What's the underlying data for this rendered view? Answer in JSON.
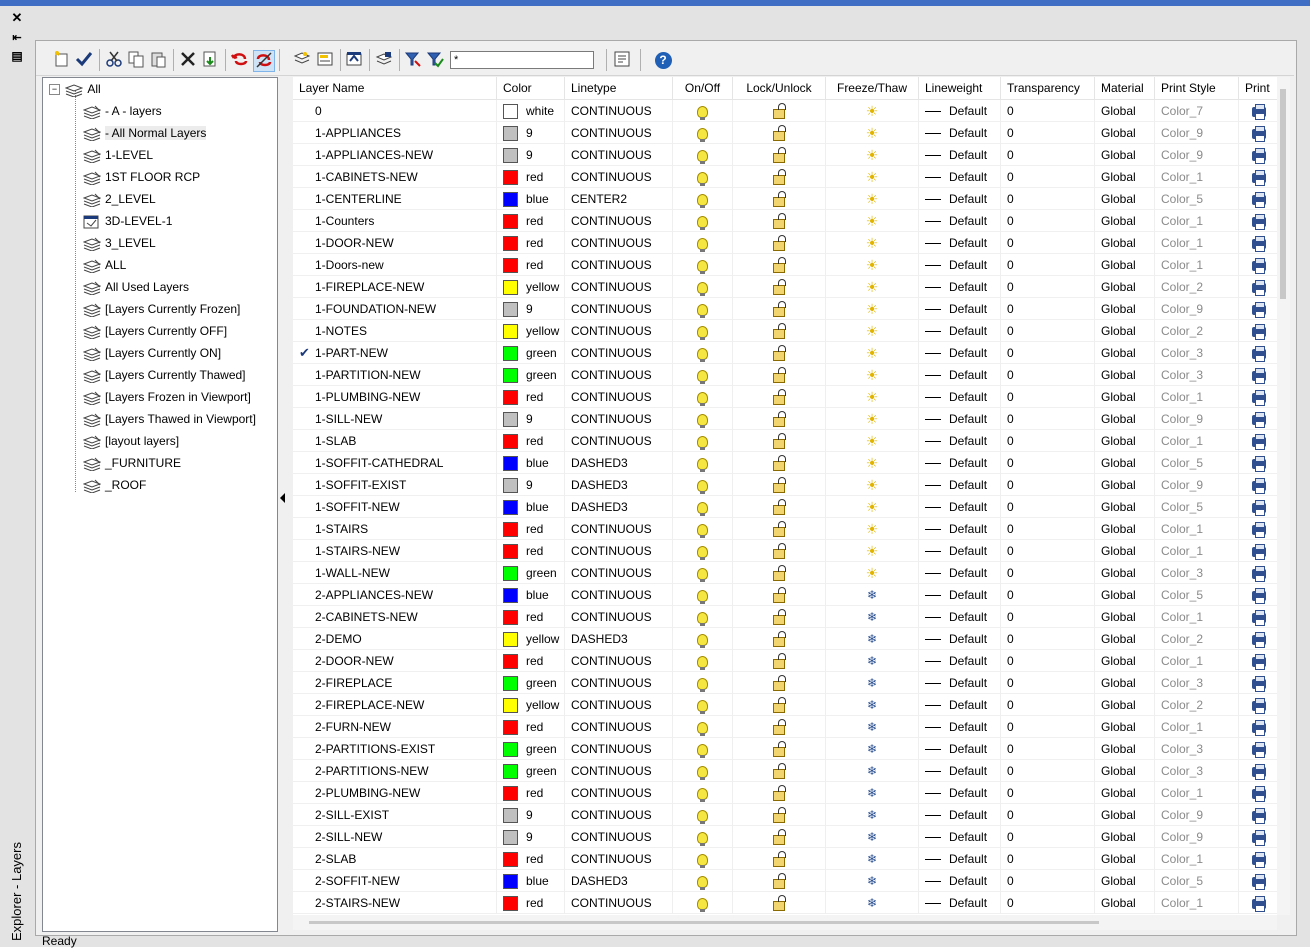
{
  "window": {
    "close_glyph": "✕",
    "pin_glyph": "⇤",
    "menu_glyph": "▤",
    "vertical_title": "Explorer - Layers",
    "status": "Ready"
  },
  "toolbar": {
    "filter_value": "*",
    "help_glyph": "?"
  },
  "tree": {
    "root": "All",
    "items": [
      "- A - layers",
      "- All Normal Layers",
      "1-LEVEL",
      "1ST FLOOR RCP",
      "2_LEVEL",
      "3D-LEVEL-1",
      "3_LEVEL",
      "ALL",
      "All Used Layers",
      "[Layers Currently Frozen]",
      "[Layers Currently OFF]",
      "[Layers Currently ON]",
      "[Layers Currently Thawed]",
      "[Layers Frozen in Viewport]",
      "[Layers Thawed in Viewport]",
      "[layout layers]",
      "_FURNITURE",
      "_ROOF"
    ],
    "selected_index": 1
  },
  "columns": [
    "Layer Name",
    "Color",
    "Linetype",
    "On/Off",
    "Lock/Unlock",
    "Freeze/Thaw",
    "Lineweight",
    "Transparency",
    "Material",
    "Print Style",
    "Print"
  ],
  "colors": {
    "white": "#ffffff",
    "9": "#c0c0c0",
    "red": "#ff0000",
    "blue": "#0000ff",
    "yellow": "#ffff00",
    "green": "#00ff00"
  },
  "current_layer_index": 11,
  "rows": [
    {
      "name": "0",
      "color": "white",
      "linetype": "CONTINUOUS",
      "freeze": "thawed",
      "lineweight": "Default",
      "transparency": "0",
      "material": "Global",
      "print_style": "Color_7"
    },
    {
      "name": "1-APPLIANCES",
      "color": "9",
      "linetype": "CONTINUOUS",
      "freeze": "thawed",
      "lineweight": "Default",
      "transparency": "0",
      "material": "Global",
      "print_style": "Color_9"
    },
    {
      "name": "1-APPLIANCES-NEW",
      "color": "9",
      "linetype": "CONTINUOUS",
      "freeze": "thawed",
      "lineweight": "Default",
      "transparency": "0",
      "material": "Global",
      "print_style": "Color_9"
    },
    {
      "name": "1-CABINETS-NEW",
      "color": "red",
      "linetype": "CONTINUOUS",
      "freeze": "thawed",
      "lineweight": "Default",
      "transparency": "0",
      "material": "Global",
      "print_style": "Color_1"
    },
    {
      "name": "1-CENTERLINE",
      "color": "blue",
      "linetype": "CENTER2",
      "freeze": "thawed",
      "lineweight": "Default",
      "transparency": "0",
      "material": "Global",
      "print_style": "Color_5"
    },
    {
      "name": "1-Counters",
      "color": "red",
      "linetype": "CONTINUOUS",
      "freeze": "thawed",
      "lineweight": "Default",
      "transparency": "0",
      "material": "Global",
      "print_style": "Color_1"
    },
    {
      "name": "1-DOOR-NEW",
      "color": "red",
      "linetype": "CONTINUOUS",
      "freeze": "thawed",
      "lineweight": "Default",
      "transparency": "0",
      "material": "Global",
      "print_style": "Color_1"
    },
    {
      "name": "1-Doors-new",
      "color": "red",
      "linetype": "CONTINUOUS",
      "freeze": "thawed",
      "lineweight": "Default",
      "transparency": "0",
      "material": "Global",
      "print_style": "Color_1"
    },
    {
      "name": "1-FIREPLACE-NEW",
      "color": "yellow",
      "linetype": "CONTINUOUS",
      "freeze": "thawed",
      "lineweight": "Default",
      "transparency": "0",
      "material": "Global",
      "print_style": "Color_2"
    },
    {
      "name": "1-FOUNDATION-NEW",
      "color": "9",
      "linetype": "CONTINUOUS",
      "freeze": "thawed",
      "lineweight": "Default",
      "transparency": "0",
      "material": "Global",
      "print_style": "Color_9"
    },
    {
      "name": "1-NOTES",
      "color": "yellow",
      "linetype": "CONTINUOUS",
      "freeze": "thawed",
      "lineweight": "Default",
      "transparency": "0",
      "material": "Global",
      "print_style": "Color_2"
    },
    {
      "name": "1-PART-NEW",
      "color": "green",
      "linetype": "CONTINUOUS",
      "freeze": "thawed",
      "lineweight": "Default",
      "transparency": "0",
      "material": "Global",
      "print_style": "Color_3"
    },
    {
      "name": "1-PARTITION-NEW",
      "color": "green",
      "linetype": "CONTINUOUS",
      "freeze": "thawed",
      "lineweight": "Default",
      "transparency": "0",
      "material": "Global",
      "print_style": "Color_3"
    },
    {
      "name": "1-PLUMBING-NEW",
      "color": "red",
      "linetype": "CONTINUOUS",
      "freeze": "thawed",
      "lineweight": "Default",
      "transparency": "0",
      "material": "Global",
      "print_style": "Color_1"
    },
    {
      "name": "1-SILL-NEW",
      "color": "9",
      "linetype": "CONTINUOUS",
      "freeze": "thawed",
      "lineweight": "Default",
      "transparency": "0",
      "material": "Global",
      "print_style": "Color_9"
    },
    {
      "name": "1-SLAB",
      "color": "red",
      "linetype": "CONTINUOUS",
      "freeze": "thawed",
      "lineweight": "Default",
      "transparency": "0",
      "material": "Global",
      "print_style": "Color_1"
    },
    {
      "name": "1-SOFFIT-CATHEDRAL",
      "color": "blue",
      "linetype": "DASHED3",
      "freeze": "thawed",
      "lineweight": "Default",
      "transparency": "0",
      "material": "Global",
      "print_style": "Color_5"
    },
    {
      "name": "1-SOFFIT-EXIST",
      "color": "9",
      "linetype": "DASHED3",
      "freeze": "thawed",
      "lineweight": "Default",
      "transparency": "0",
      "material": "Global",
      "print_style": "Color_9"
    },
    {
      "name": "1-SOFFIT-NEW",
      "color": "blue",
      "linetype": "DASHED3",
      "freeze": "thawed",
      "lineweight": "Default",
      "transparency": "0",
      "material": "Global",
      "print_style": "Color_5"
    },
    {
      "name": "1-STAIRS",
      "color": "red",
      "linetype": "CONTINUOUS",
      "freeze": "thawed",
      "lineweight": "Default",
      "transparency": "0",
      "material": "Global",
      "print_style": "Color_1"
    },
    {
      "name": "1-STAIRS-NEW",
      "color": "red",
      "linetype": "CONTINUOUS",
      "freeze": "thawed",
      "lineweight": "Default",
      "transparency": "0",
      "material": "Global",
      "print_style": "Color_1"
    },
    {
      "name": "1-WALL-NEW",
      "color": "green",
      "linetype": "CONTINUOUS",
      "freeze": "thawed",
      "lineweight": "Default",
      "transparency": "0",
      "material": "Global",
      "print_style": "Color_3"
    },
    {
      "name": "2-APPLIANCES-NEW",
      "color": "blue",
      "linetype": "CONTINUOUS",
      "freeze": "frozen",
      "lineweight": "Default",
      "transparency": "0",
      "material": "Global",
      "print_style": "Color_5"
    },
    {
      "name": "2-CABINETS-NEW",
      "color": "red",
      "linetype": "CONTINUOUS",
      "freeze": "frozen",
      "lineweight": "Default",
      "transparency": "0",
      "material": "Global",
      "print_style": "Color_1"
    },
    {
      "name": "2-DEMO",
      "color": "yellow",
      "linetype": "DASHED3",
      "freeze": "frozen",
      "lineweight": "Default",
      "transparency": "0",
      "material": "Global",
      "print_style": "Color_2"
    },
    {
      "name": "2-DOOR-NEW",
      "color": "red",
      "linetype": "CONTINUOUS",
      "freeze": "frozen",
      "lineweight": "Default",
      "transparency": "0",
      "material": "Global",
      "print_style": "Color_1"
    },
    {
      "name": "2-FIREPLACE",
      "color": "green",
      "linetype": "CONTINUOUS",
      "freeze": "frozen",
      "lineweight": "Default",
      "transparency": "0",
      "material": "Global",
      "print_style": "Color_3"
    },
    {
      "name": "2-FIREPLACE-NEW",
      "color": "yellow",
      "linetype": "CONTINUOUS",
      "freeze": "frozen",
      "lineweight": "Default",
      "transparency": "0",
      "material": "Global",
      "print_style": "Color_2"
    },
    {
      "name": "2-FURN-NEW",
      "color": "red",
      "linetype": "CONTINUOUS",
      "freeze": "frozen",
      "lineweight": "Default",
      "transparency": "0",
      "material": "Global",
      "print_style": "Color_1"
    },
    {
      "name": "2-PARTITIONS-EXIST",
      "color": "green",
      "linetype": "CONTINUOUS",
      "freeze": "frozen",
      "lineweight": "Default",
      "transparency": "0",
      "material": "Global",
      "print_style": "Color_3"
    },
    {
      "name": "2-PARTITIONS-NEW",
      "color": "green",
      "linetype": "CONTINUOUS",
      "freeze": "frozen",
      "lineweight": "Default",
      "transparency": "0",
      "material": "Global",
      "print_style": "Color_3"
    },
    {
      "name": "2-PLUMBING-NEW",
      "color": "red",
      "linetype": "CONTINUOUS",
      "freeze": "frozen",
      "lineweight": "Default",
      "transparency": "0",
      "material": "Global",
      "print_style": "Color_1"
    },
    {
      "name": "2-SILL-EXIST",
      "color": "9",
      "linetype": "CONTINUOUS",
      "freeze": "frozen",
      "lineweight": "Default",
      "transparency": "0",
      "material": "Global",
      "print_style": "Color_9"
    },
    {
      "name": "2-SILL-NEW",
      "color": "9",
      "linetype": "CONTINUOUS",
      "freeze": "frozen",
      "lineweight": "Default",
      "transparency": "0",
      "material": "Global",
      "print_style": "Color_9"
    },
    {
      "name": "2-SLAB",
      "color": "red",
      "linetype": "CONTINUOUS",
      "freeze": "frozen",
      "lineweight": "Default",
      "transparency": "0",
      "material": "Global",
      "print_style": "Color_1"
    },
    {
      "name": "2-SOFFIT-NEW",
      "color": "blue",
      "linetype": "DASHED3",
      "freeze": "frozen",
      "lineweight": "Default",
      "transparency": "0",
      "material": "Global",
      "print_style": "Color_5"
    },
    {
      "name": "2-STAIRS-NEW",
      "color": "red",
      "linetype": "CONTINUOUS",
      "freeze": "frozen",
      "lineweight": "Default",
      "transparency": "0",
      "material": "Global",
      "print_style": "Color_1"
    }
  ]
}
